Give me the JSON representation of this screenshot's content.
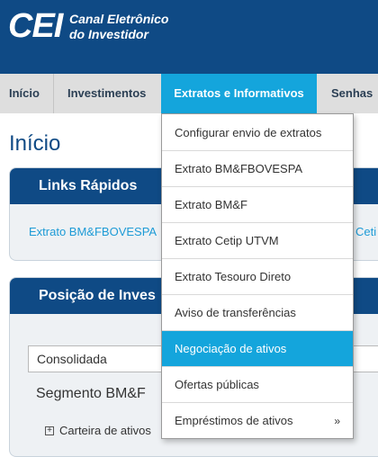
{
  "header": {
    "logo": "CEI",
    "subtitle_line1": "Canal Eletrônico",
    "subtitle_line2": "do Investidor"
  },
  "nav": {
    "items": [
      "Início",
      "Investimentos",
      "Extratos e Informativos",
      "Senhas"
    ],
    "active": "Extratos e Informativos"
  },
  "page": {
    "title": "Início"
  },
  "quick_links": {
    "title": "Links Rápidos",
    "link1": "Extrato BM&FBOVESPA",
    "link2_partial": "Ceti"
  },
  "position": {
    "title_partial": "Posição de Inves",
    "select_value": "Consolidada",
    "segment_partial": "Segmento BM&F",
    "tree_item_partial": "Carteira de ativos"
  },
  "dropdown": {
    "items": [
      "Configurar envio de extratos",
      "Extrato BM&FBOVESPA",
      "Extrato BM&F",
      "Extrato Cetip UTVM",
      "Extrato Tesouro Direto",
      "Aviso de transferências",
      "Negociação de ativos",
      "Ofertas públicas",
      "Empréstimos de ativos"
    ],
    "highlighted": "Negociação de ativos",
    "submenu_arrow": "»"
  },
  "colors": {
    "brand_blue": "#0f4a85",
    "accent_blue": "#14a5dc",
    "link_blue": "#1d9bd6"
  }
}
